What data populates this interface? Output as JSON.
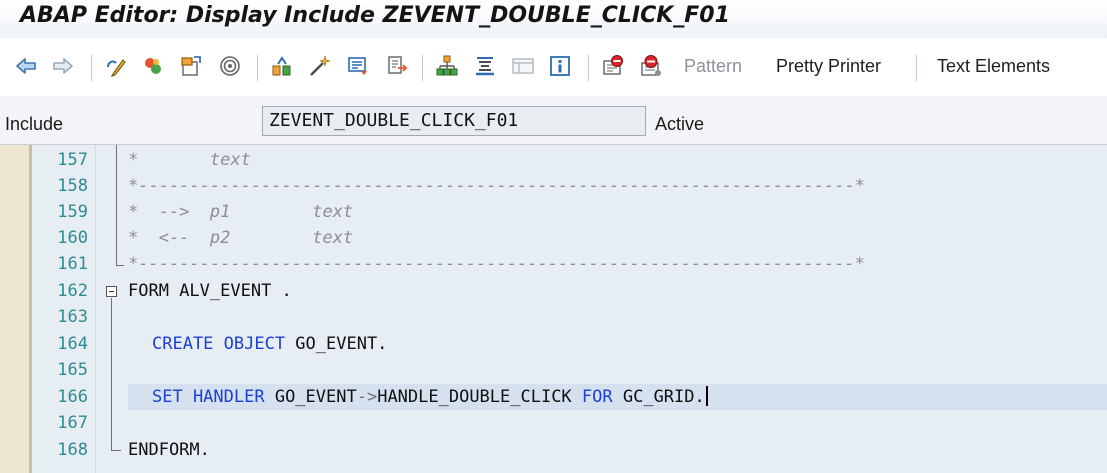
{
  "window": {
    "title": "ABAP Editor: Display Include ZEVENT_DOUBLE_CLICK_F01"
  },
  "toolbar": {
    "icons": [
      {
        "name": "back-arrow-icon"
      },
      {
        "name": "forward-arrow-icon"
      },
      {
        "name": "display-change-icon"
      },
      {
        "name": "active-inactive-icon"
      },
      {
        "name": "other-object-icon"
      },
      {
        "name": "where-used-icon"
      },
      {
        "name": "check-syntax-icon"
      },
      {
        "name": "activate-icon"
      },
      {
        "name": "test-icon"
      },
      {
        "name": "display-object-list-icon"
      },
      {
        "name": "navigation-window-icon"
      },
      {
        "name": "hierarchy-icon"
      },
      {
        "name": "layout-icon"
      },
      {
        "name": "help-info-icon"
      },
      {
        "name": "set-breakpoint-session-icon"
      },
      {
        "name": "set-breakpoint-external-icon"
      }
    ],
    "pattern_label": "Pattern",
    "pretty_printer_label": "Pretty Printer",
    "text_elements_label": "Text Elements"
  },
  "include_row": {
    "label": "Include",
    "value": "ZEVENT_DOUBLE_CLICK_F01",
    "status": "Active"
  },
  "editor": {
    "line_numbers": [
      "157",
      "158",
      "159",
      "160",
      "161",
      "162",
      "163",
      "164",
      "165",
      "166",
      "167",
      "168"
    ],
    "lines": {
      "l157": "*       text",
      "l158": "*----------------------------------------------------------------------*",
      "l159": "*  -->  p1        text",
      "l160": "*  <--  p2        text",
      "l161": "*----------------------------------------------------------------------*",
      "l162_kw": "FORM",
      "l162_rest": " ALV_EVENT .",
      "l164_kw": "CREATE OBJECT",
      "l164_rest": " GO_EVENT.",
      "l166_kw": "SET HANDLER",
      "l166_obj": " GO_EVENT",
      "l166_arrow": "->",
      "l166_method": "HANDLE_DOUBLE_CLICK ",
      "l166_kw2": "FOR",
      "l166_rest": " GC_GRID.",
      "l168_kw": "ENDFORM",
      "l168_rest": "."
    },
    "current_line": "166"
  },
  "colors": {
    "keyword": "#1d3fd4",
    "comment": "#8b8f94",
    "line_number": "#2d8b92",
    "editor_background": "#e6eef4"
  }
}
